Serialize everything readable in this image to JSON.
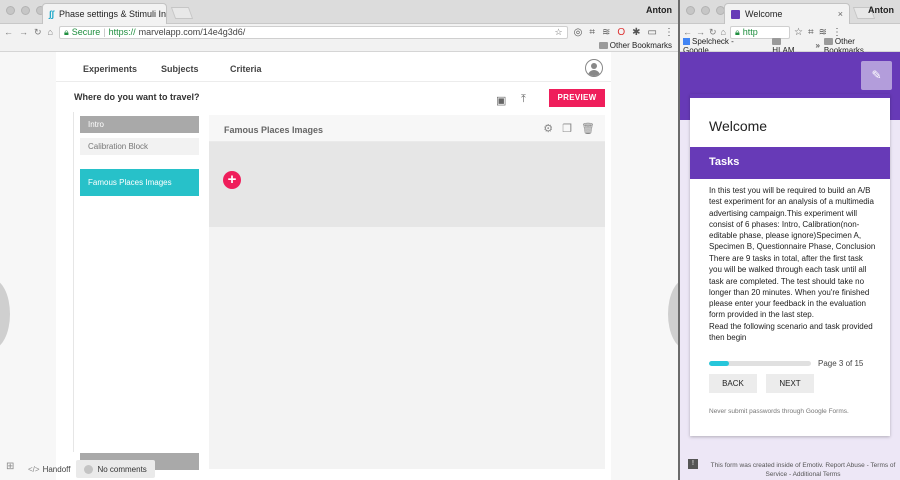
{
  "left_browser": {
    "tab_title": "Phase settings & Stimuli Intr",
    "tab_close": "×",
    "profile": "Anton",
    "secure_label": "Secure",
    "url_scheme": "https://",
    "url_rest": "marvelapp.com/14e4g3d6/",
    "bookmark_other": "Other Bookmarks"
  },
  "marvel": {
    "nav": [
      "Experiments",
      "Subjects",
      "Criteria"
    ],
    "question": "Where do you want to travel?",
    "preview_label": "PREVIEW",
    "phases": [
      "Intro",
      "Calibration Block",
      "Famous Places Images"
    ],
    "panel_title": "Famous Places Images",
    "add_label": "+",
    "bottom": {
      "handoff": "Handoff",
      "comments": "No comments"
    }
  },
  "right_browser": {
    "tab_title": "Welcome",
    "tab_close": "×",
    "profile": "Anton",
    "url_scheme": "http",
    "bookmarks": [
      "Spelcheck - Google...",
      "HLAM"
    ],
    "bookmark_other": "Other Bookmarks"
  },
  "gform": {
    "title": "Welcome",
    "section": "Tasks",
    "paragraphs": [
      "In this test you will be required to build an A/B test experiment for an analysis of a multimedia advertising campaign.This experiment will consist of 6 phases: Intro, Calibration(non-editable phase, please ignore)Specimen A, Specimen B, Questionnaire Phase, Conclusion",
      "There are 9 tasks in total, after the first task you will be walked through each task until all task are completed. The test should take no longer than 20 minutes. When you're finished please enter your feedback in the evaluation form provided in the last step.",
      "Read the following scenario and task provided then begin"
    ],
    "progress_percent": 20,
    "page_text": "Page 3 of 15",
    "back_label": "BACK",
    "next_label": "NEXT",
    "warning": "Never submit passwords through Google Forms.",
    "footer": "This form was created inside of Emotiv. Report Abuse - Terms of Service - Additional Terms"
  }
}
